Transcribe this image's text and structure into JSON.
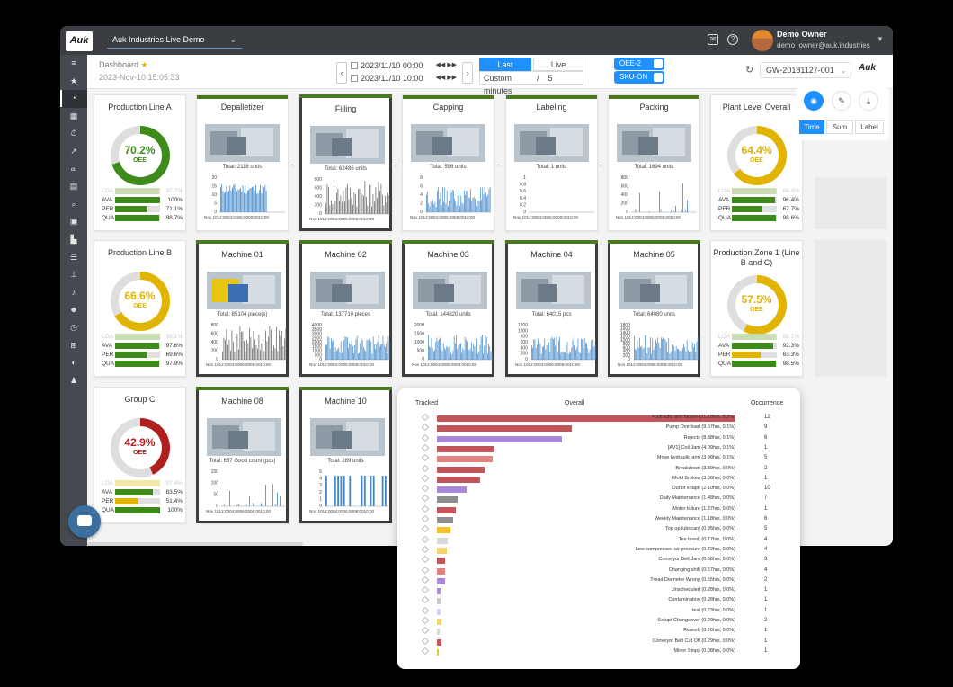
{
  "app": {
    "logo": "Auk",
    "workspace": "Auk Industries Live Demo",
    "user_name": "Demo Owner",
    "user_email": "demo_owner@auk.industries"
  },
  "sidebar_icons": [
    "menu-icon",
    "star-icon",
    "dashboard-icon",
    "grid-icon",
    "timer-icon",
    "chart-icon",
    "link-icon",
    "document-icon",
    "search-icon",
    "chip-icon",
    "factory-icon",
    "list-icon",
    "hierarchy-icon",
    "bell-icon",
    "users-icon",
    "clock-icon",
    "table-icon",
    "palette-icon",
    "user-admin-icon"
  ],
  "header": {
    "title": "Dashboard",
    "datetime": "2023-Nov-10 15:05:33",
    "start": "2023/11/10 00:00",
    "end": "2023/11/10 10:00",
    "last_label": "Last",
    "live_label": "Live",
    "custom_label": "Custom",
    "sep": "/",
    "interval": "5 minutes",
    "oee_toggle": "OEE-2",
    "sku_toggle": "SKU-ON",
    "gateway": "GW-20181127-001",
    "brand": "Auk"
  },
  "tools": {
    "time": "Time",
    "sum": "Sum",
    "label": "Label"
  },
  "oee_cards": [
    {
      "title": "Production Line A",
      "oee": "70.2%",
      "sub": "OEE",
      "color": "#3e8a1a",
      "pct": 70.2,
      "metrics": [
        {
          "k": "LOA",
          "v": "97.7%",
          "f": 97.7,
          "c": "#c9dcb4",
          "faded": true
        },
        {
          "k": "AVA",
          "v": "100%",
          "f": 100,
          "c": "#3e8a1a"
        },
        {
          "k": "PER",
          "v": "71.1%",
          "f": 71.1,
          "c": "#3e8a1a"
        },
        {
          "k": "QUA",
          "v": "98.7%",
          "f": 98.7,
          "c": "#3e8a1a"
        }
      ]
    },
    {
      "title": "Plant Level Overall",
      "oee": "64.4%",
      "sub": "OEE",
      "color": "#e0b400",
      "pct": 64.4,
      "metrics": [
        {
          "k": "LOA",
          "v": "98.4%",
          "f": 98.4,
          "c": "#c9dcb4",
          "faded": true
        },
        {
          "k": "AVA",
          "v": "96.4%",
          "f": 96.4,
          "c": "#3e8a1a"
        },
        {
          "k": "PER",
          "v": "67.7%",
          "f": 67.7,
          "c": "#3e8a1a"
        },
        {
          "k": "QUA",
          "v": "98.6%",
          "f": 98.6,
          "c": "#3e8a1a"
        }
      ]
    },
    {
      "title": "Production Line B",
      "oee": "66.6%",
      "sub": "OEE",
      "color": "#e0b400",
      "pct": 66.6,
      "metrics": [
        {
          "k": "LOA",
          "v": "99.1%",
          "f": 99.1,
          "c": "#c9dcb4",
          "faded": true
        },
        {
          "k": "AVA",
          "v": "97.6%",
          "f": 97.6,
          "c": "#3e8a1a"
        },
        {
          "k": "PER",
          "v": "69.6%",
          "f": 69.6,
          "c": "#3e8a1a"
        },
        {
          "k": "QUA",
          "v": "97.9%",
          "f": 97.9,
          "c": "#3e8a1a"
        }
      ]
    },
    {
      "title": "Production Zone 1 (Line B and C)",
      "oee": "57.5%",
      "sub": "OEE",
      "color": "#e0b400",
      "pct": 57.5,
      "metrics": [
        {
          "k": "LOA",
          "v": "98.1%",
          "f": 98.1,
          "c": "#c9dcb4",
          "faded": true
        },
        {
          "k": "AVA",
          "v": "92.3%",
          "f": 92.3,
          "c": "#3e8a1a"
        },
        {
          "k": "PER",
          "v": "63.3%",
          "f": 63.3,
          "c": "#e0b400"
        },
        {
          "k": "QUA",
          "v": "98.5%",
          "f": 98.5,
          "c": "#3e8a1a"
        }
      ]
    },
    {
      "title": "Group C",
      "oee": "42.9%",
      "sub": "OEE",
      "color": "#b01e1e",
      "pct": 42.9,
      "metrics": [
        {
          "k": "LOA",
          "v": "97.4%",
          "f": 97.4,
          "c": "#f3e7a8",
          "faded": true
        },
        {
          "k": "AVA",
          "v": "83.5%",
          "f": 83.5,
          "c": "#3e8a1a"
        },
        {
          "k": "PER",
          "v": "51.4%",
          "f": 51.4,
          "c": "#e0b400"
        },
        {
          "k": "QUA",
          "v": "100%",
          "f": 100,
          "c": "#3e8a1a"
        }
      ]
    }
  ],
  "machine_cards": [
    {
      "title": "Depalletizer",
      "total": "Total: 2118 units",
      "yticks": [
        "20",
        "15",
        "10",
        "5",
        "0"
      ],
      "xlabel": "Nov 1012:0004:0006:0008:0010:00",
      "style": "dense",
      "active": false
    },
    {
      "title": "Filling",
      "total": "Total: 62486 units",
      "yticks": [
        "800",
        "600",
        "400",
        "200",
        "0"
      ],
      "xlabel": "Nov 1012:0004:0006:0008:0010:00",
      "style": "gray",
      "active": true
    },
    {
      "title": "Capping",
      "total": "Total: 596 units",
      "yticks": [
        "8",
        "6",
        "4",
        "2",
        "0"
      ],
      "xlabel": "Nov 1012:0004:0006:0008:0010:00",
      "style": "wavy",
      "active": false
    },
    {
      "title": "Labeling",
      "total": "Total: 1 units",
      "yticks": [
        "1",
        "0.8",
        "0.6",
        "0.4",
        "0.2",
        "0"
      ],
      "xlabel": "Nov 1012:0004:0006:0008:0010:00",
      "style": "empty",
      "active": false
    },
    {
      "title": "Packing",
      "total": "Total: 1694 units",
      "yticks": [
        "800",
        "600",
        "400",
        "200",
        "0"
      ],
      "xlabel": "Nov 1012:0004:0006:0008:0010:00",
      "style": "sparse",
      "active": false
    },
    {
      "title": "Machine 01",
      "total": "Total: 85104 piece(s)",
      "yticks": [
        "800",
        "600",
        "400",
        "200",
        "0"
      ],
      "xlabel": "Nov 1012:0004:0006:0008:0010:00",
      "style": "gray",
      "active": true
    },
    {
      "title": "Machine 02",
      "total": "Total: 137710 pieces",
      "yticks": [
        "4000",
        "3500",
        "3000",
        "2500",
        "2000",
        "1500",
        "1000",
        "500",
        "0"
      ],
      "xlabel": "Nov 1012:0004:0006:0008:0010:00",
      "style": "wavy",
      "active": true
    },
    {
      "title": "Machine 03",
      "total": "Total: 144820 units",
      "yticks": [
        "2000",
        "1500",
        "1000",
        "500",
        "0"
      ],
      "xlabel": "Nov 1012:0004:0006:0008:0010:00",
      "style": "wavy",
      "active": true
    },
    {
      "title": "Machine 04",
      "total": "Total: 64015 pcs",
      "yticks": [
        "1200",
        "1000",
        "800",
        "600",
        "400",
        "200",
        "0"
      ],
      "xlabel": "Nov 1012:0004:0006:0008:0010:00",
      "style": "wavy",
      "active": true
    },
    {
      "title": "Machine 05",
      "total": "Total: 64080 units",
      "yticks": [
        "1800",
        "1600",
        "1400",
        "1200",
        "1000",
        "800",
        "600",
        "400",
        "200",
        "0"
      ],
      "xlabel": "Nov 1012:0004:0006:0008:0010:00",
      "style": "wavy",
      "active": true
    },
    {
      "title": "Machine 08",
      "total": "Total: 657 Good count (pcs)",
      "yticks": [
        "150",
        "100",
        "50",
        "0"
      ],
      "xlabel": "Nov 1012:0004:0006:0008:0010:00",
      "style": "sparse",
      "active": true
    },
    {
      "title": "Machine 10",
      "total": "Total: 289 units",
      "yticks": [
        "5",
        "4",
        "3",
        "2",
        "1",
        "0"
      ],
      "xlabel": "Nov 1012:0004:0006:0008:0010:00",
      "style": "blocks",
      "active": true
    }
  ],
  "pareto": {
    "h_tracked": "Tracked",
    "h_overall": "Overall",
    "h_occurrence": "Occurrence",
    "rows": [
      {
        "label": "Hydraulic arm failure (21.18hrs, 0.2%)",
        "value": 21.18,
        "occ": "12",
        "color": "#c0555a"
      },
      {
        "label": "Pump Overload (9.57hrs, 0.1%)",
        "value": 9.57,
        "occ": "9",
        "color": "#c0555a"
      },
      {
        "label": "Rejects (8.88hrs, 0.1%)",
        "value": 8.88,
        "occ": "6",
        "color": "#a98ad8"
      },
      {
        "label": "[AV1] Coil Jam (4.09hrs, 0.1%)",
        "value": 4.09,
        "occ": "1",
        "color": "#c0555a"
      },
      {
        "label": "Move hydraulic arm (3.98hrs, 0.1%)",
        "value": 3.98,
        "occ": "5",
        "color": "#e3837f"
      },
      {
        "label": "Breakdown (3.39hrs, 0.0%)",
        "value": 3.39,
        "occ": "2",
        "color": "#c0555a"
      },
      {
        "label": "Mold Broken (3.08hrs, 0.0%)",
        "value": 3.08,
        "occ": "1",
        "color": "#c0555a"
      },
      {
        "label": "Out of shape (2.10hrs, 0.0%)",
        "value": 2.1,
        "occ": "10",
        "color": "#a98ad8"
      },
      {
        "label": "Daily Maintenance (1.48hrs, 0.0%)",
        "value": 1.48,
        "occ": "7",
        "color": "#8d8d8d"
      },
      {
        "label": "Motor failure (1.37hrs, 0.0%)",
        "value": 1.37,
        "occ": "1",
        "color": "#c0555a"
      },
      {
        "label": "Weekly Maintenance (1.18hrs, 0.0%)",
        "value": 1.18,
        "occ": "6",
        "color": "#8d8d8d"
      },
      {
        "label": "Top up lubricant (0.95hrs, 0.0%)",
        "value": 0.95,
        "occ": "5",
        "color": "#f3c32c"
      },
      {
        "label": "Tea break (0.77hrs, 0.0%)",
        "value": 0.77,
        "occ": "4",
        "color": "#d8d8d8"
      },
      {
        "label": "Low compressed air pressure (0.72hrs, 0.0%)",
        "value": 0.72,
        "occ": "4",
        "color": "#f3d66b"
      },
      {
        "label": "Conveyor Belt Jam (0.58hrs, 0.0%)",
        "value": 0.58,
        "occ": "3",
        "color": "#c0555a"
      },
      {
        "label": "Changing shift (0.57hrs, 0.0%)",
        "value": 0.57,
        "occ": "4",
        "color": "#e3837f"
      },
      {
        "label": "Tread Diameter Wrong (0.55hrs, 0.0%)",
        "value": 0.55,
        "occ": "2",
        "color": "#a98ad8"
      },
      {
        "label": "Unscheduled (0.28hrs, 0.0%)",
        "value": 0.28,
        "occ": "1",
        "color": "#a98ad8"
      },
      {
        "label": "Contamination (0.28hrs, 0.0%)",
        "value": 0.28,
        "occ": "1",
        "color": "#c9c9c9"
      },
      {
        "label": "test (0.23hrs, 0.0%)",
        "value": 0.23,
        "occ": "1",
        "color": "#d8d0ec"
      },
      {
        "label": "Setup/ Changeover (0.29hrs, 0.0%)",
        "value": 0.29,
        "occ": "2",
        "color": "#f3d66b"
      },
      {
        "label": "Rework (0.20hrs, 0.0%)",
        "value": 0.2,
        "occ": "1",
        "color": "#d8d8d8"
      },
      {
        "label": "Conveyor Belt Cut Off (0.29hrs, 0.0%)",
        "value": 0.29,
        "occ": "1",
        "color": "#c0555a"
      },
      {
        "label": "Minor Stops (0.08hrs, 0.0%)",
        "value": 0.08,
        "occ": "1",
        "color": "#f3c32c"
      }
    ]
  }
}
